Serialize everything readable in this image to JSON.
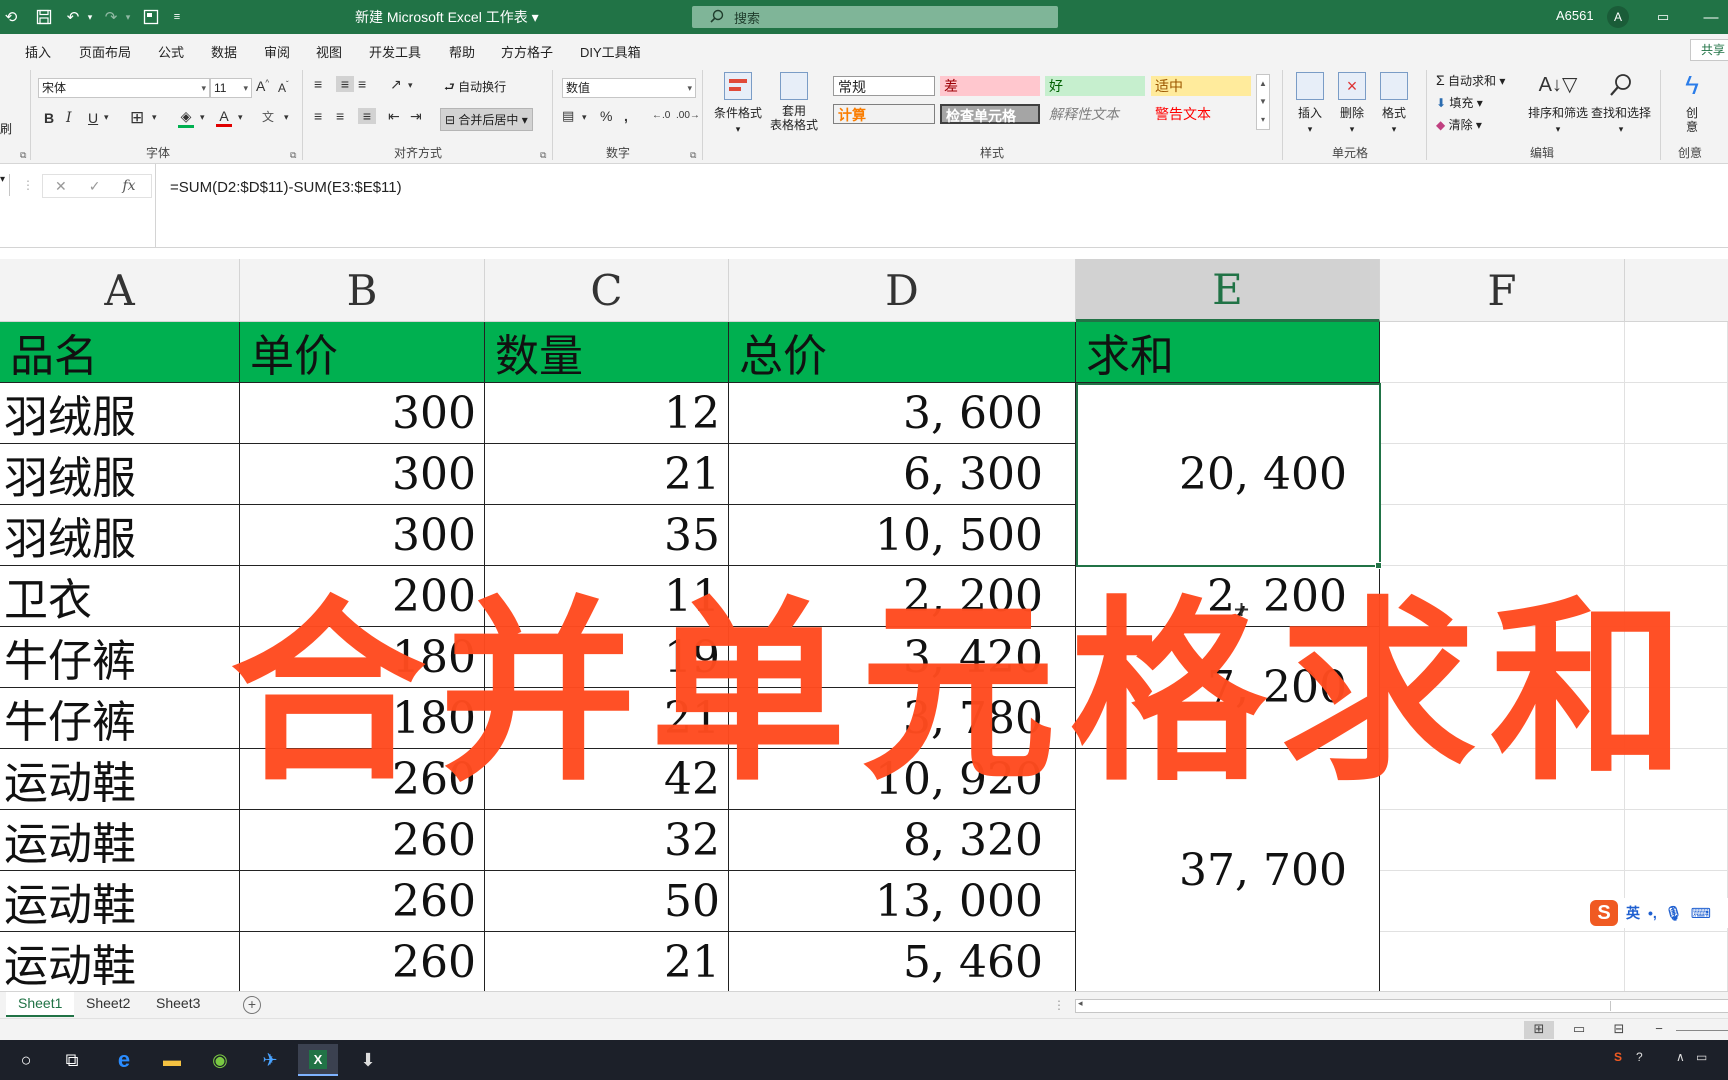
{
  "window": {
    "title": "新建 Microsoft Excel 工作表",
    "search_placeholder": "搜索",
    "user_label": "A6561",
    "avatar_letter": "A",
    "accent_color": "#217346"
  },
  "ribbon_tabs": [
    "插入",
    "页面布局",
    "公式",
    "数据",
    "审阅",
    "视图",
    "开发工具",
    "帮助",
    "方方格子",
    "DIY工具箱"
  ],
  "share_label": "共享",
  "ribbon": {
    "left_stub": "刷",
    "font": {
      "name": "宋体",
      "size": "11",
      "group_label": "字体"
    },
    "alignment": {
      "wrap_text": "自动换行",
      "merge_center": "合并后居中",
      "group_label": "对齐方式"
    },
    "number": {
      "format": "数值",
      "group_label": "数字"
    },
    "styles": {
      "conditional_format": "条件格式",
      "format_as_table": "套用\n表格格式",
      "normal": "常规",
      "bad": "差",
      "good": "好",
      "neutral": "适中",
      "calculation": "计算",
      "check_cell": "检查单元格",
      "explanatory": "解释性文本",
      "warning": "警告文本",
      "group_label": "样式"
    },
    "cells": {
      "insert": "插入",
      "delete": "删除",
      "format": "格式",
      "group_label": "单元格"
    },
    "editing": {
      "autosum": "自动求和",
      "fill": "填充",
      "clear": "清除",
      "sort_filter": "排序和筛选",
      "find_select": "查找和选择",
      "group_label": "编辑"
    },
    "create": {
      "label": "创意",
      "group_label": "创意"
    }
  },
  "formula_bar": {
    "formula": "=SUM(D2:$D$11)-SUM(E3:$E$11)"
  },
  "columns": [
    "A",
    "B",
    "C",
    "D",
    "E",
    "F"
  ],
  "selected_column": "E",
  "header_row": [
    "品名",
    "单价",
    "数量",
    "总价",
    "求和"
  ],
  "rows": [
    [
      "羽绒服",
      "300",
      "12",
      "3, 600"
    ],
    [
      "羽绒服",
      "300",
      "21",
      "6, 300"
    ],
    [
      "羽绒服",
      "300",
      "35",
      "10, 500"
    ],
    [
      "卫衣",
      "200",
      "11",
      "2, 200"
    ],
    [
      "牛仔裤",
      "180",
      "19",
      "3, 420"
    ],
    [
      "牛仔裤",
      "180",
      "21",
      "3, 780"
    ],
    [
      "运动鞋",
      "260",
      "42",
      "10, 920"
    ],
    [
      "运动鞋",
      "260",
      "32",
      "8, 320"
    ],
    [
      "运动鞋",
      "260",
      "50",
      "13, 000"
    ],
    [
      "运动鞋",
      "260",
      "21",
      "5, 460"
    ]
  ],
  "merged_sums": [
    {
      "value": "20, 400",
      "rows": "2-4"
    },
    {
      "value": "2, 200",
      "rows": "5"
    },
    {
      "value": "7, 200",
      "rows": "6-7"
    },
    {
      "value": "37, 700",
      "rows": "8-11"
    }
  ],
  "overlay_caption": "合并单元格求和",
  "overlay_color": "#ff4b1f",
  "header_fill_color": "#00b050",
  "sheets": [
    "Sheet1",
    "Sheet2",
    "Sheet3"
  ],
  "active_sheet": "Sheet1",
  "ime": {
    "logo": "S",
    "mode": "英"
  }
}
